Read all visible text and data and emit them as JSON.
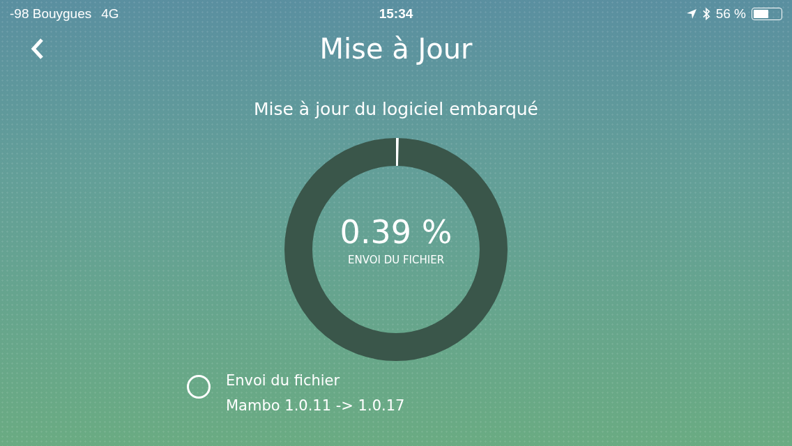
{
  "status_bar": {
    "carrier": "-98 Bouygues",
    "network": "4G",
    "time": "15:34",
    "battery": "56 %"
  },
  "header": {
    "title": "Mise à Jour"
  },
  "subtitle": "Mise à jour du logiciel embarqué",
  "progress": {
    "percent": "0.39 %",
    "label": "ENVOI DU FICHIER"
  },
  "steps": [
    {
      "title": "Envoi du fichier",
      "detail": "Mambo 1.0.11 -> 1.0.17",
      "done": false
    }
  ]
}
